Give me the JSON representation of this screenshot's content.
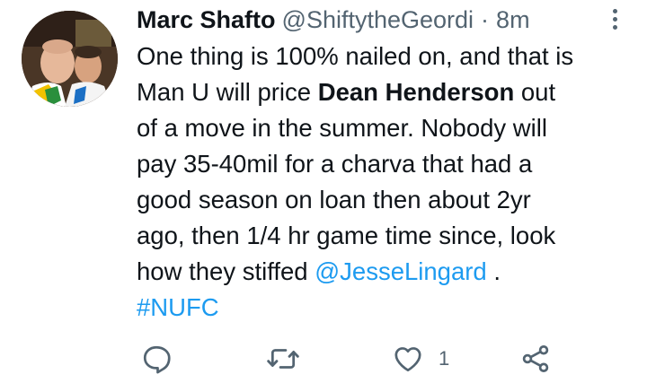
{
  "tweet": {
    "display_name": "Marc Shafto",
    "handle": "@ShiftytheGeordi",
    "separator": "·",
    "time": "8m",
    "text": {
      "line1": "One thing is 100% nailed on, and that is",
      "line2_prefix": "Man U will price ",
      "line2_bold": "Dean Henderson",
      "line2_suffix": " out",
      "line3": "of a move in the summer. Nobody will",
      "line4": "pay 35-40mil for a charva that had a",
      "line5": "good season on loan then about 2yr",
      "line6": "ago, then 1/4 hr game time since, look",
      "line7_prefix": "how they stiffed ",
      "line7_mention": "@JesseLingard",
      "line7_suffix": " .",
      "hashtag": "#NUFC"
    },
    "actions": {
      "reply_icon": "reply-icon",
      "retweet_icon": "retweet-icon",
      "like_icon": "heart-icon",
      "like_count": "1",
      "share_icon": "share-icon"
    }
  },
  "colors": {
    "link": "#1d9bf0",
    "secondary": "#536471",
    "primary_text": "#0f1419"
  }
}
